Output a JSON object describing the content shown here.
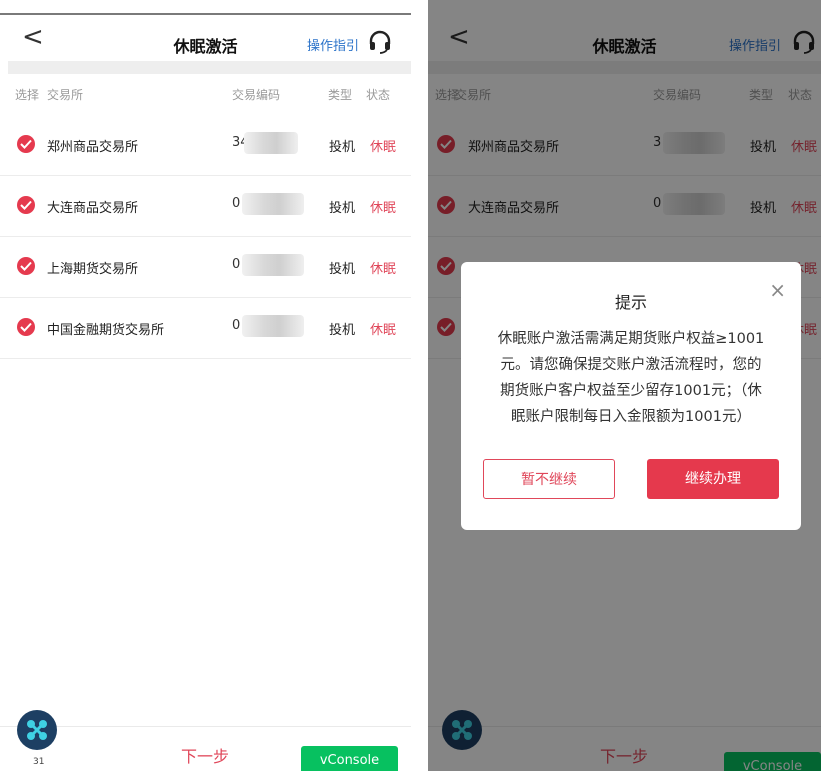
{
  "header": {
    "back_label": "<",
    "title": "休眠激活",
    "guide_label": "操作指引"
  },
  "columns": {
    "select": "选择",
    "exchange": "交易所",
    "code": "交易编码",
    "type": "类型",
    "status": "状态"
  },
  "rows": [
    {
      "exchange": "郑州商品交易所",
      "code": "34",
      "type": "投机",
      "status": "休眠"
    },
    {
      "exchange": "大连商品交易所",
      "code": "0",
      "type": "投机",
      "status": "休眠"
    },
    {
      "exchange": "上海期货交易所",
      "code": "0",
      "type": "投机",
      "status": "休眠"
    },
    {
      "exchange": "中国金融期货交易所",
      "code": "0",
      "type": "投机",
      "status": "休眠"
    }
  ],
  "right_rows": [
    {
      "exchange": "郑州商品交易所",
      "code": "3",
      "type": "投机",
      "status": "休眠"
    },
    {
      "exchange": "大连商品交易所",
      "code": "0",
      "type": "投机",
      "status": "休眠"
    },
    {
      "exchange": "",
      "code": "",
      "type": "",
      "status": "休眠"
    },
    {
      "exchange": "",
      "code": "",
      "type": "",
      "status": "休眠"
    }
  ],
  "footer": {
    "next_label": "下一步",
    "vconsole_label": "vConsole",
    "logo_number": "31"
  },
  "dialog": {
    "title": "提示",
    "close": "×",
    "line1": "休眠账户激活需满足期货账户权益≥1001",
    "line2": "元。请您确保提交账户激活流程时，您的",
    "line3": "期货账户客户权益至少留存1001元；（休",
    "line4": "眠账户限制每日入金限额为1001元）",
    "cancel_label": "暂不继续",
    "continue_label": "继续办理"
  },
  "colors": {
    "accent": "#e5394d",
    "link": "#2b73c9",
    "vconsole": "#07c160"
  },
  "icons": {
    "back": "chevron-left-icon",
    "support": "headset-icon",
    "check": "check-circle-icon",
    "close": "close-icon"
  }
}
